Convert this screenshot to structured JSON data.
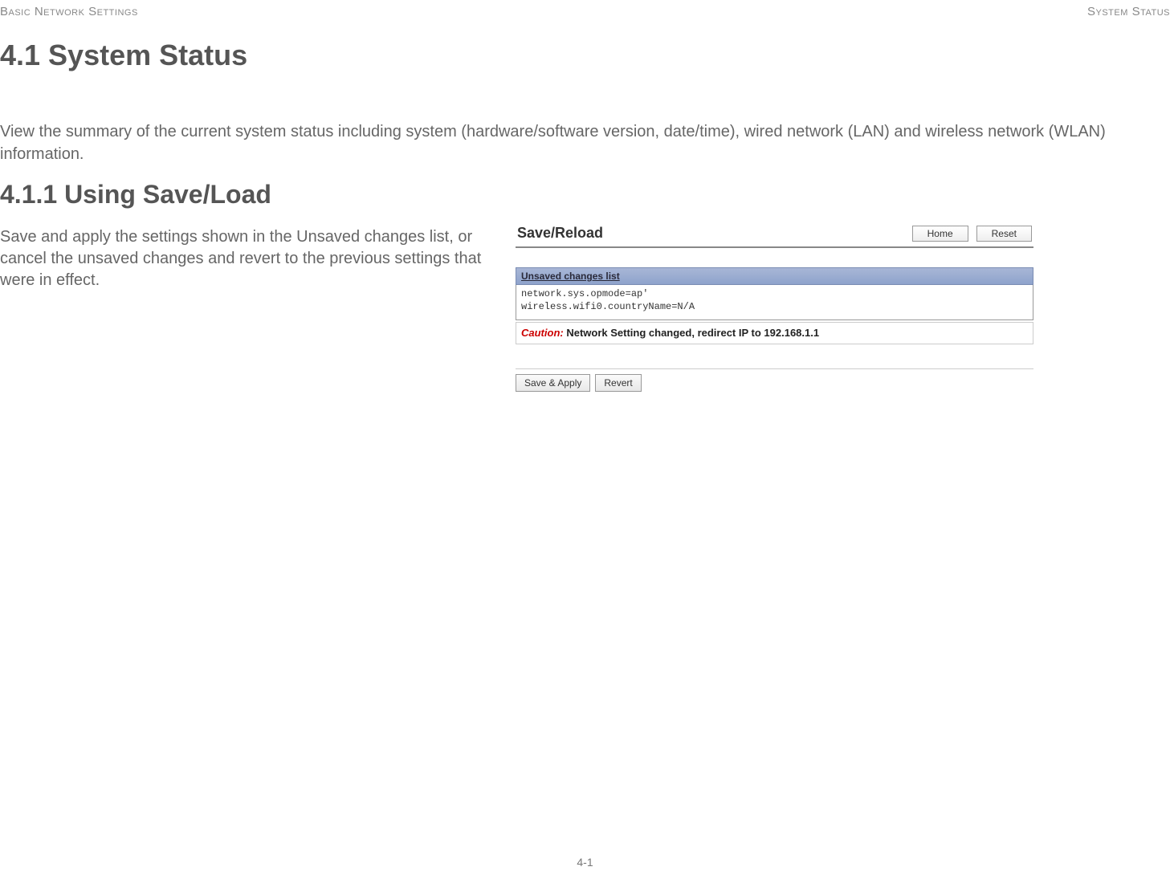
{
  "header": {
    "left": "Basic Network Settings",
    "right": "System Status"
  },
  "section": {
    "heading": "4.1 System Status",
    "description": "View the summary of the current system status including system (hardware/software version, date/time), wired network (LAN) and wireless network (WLAN) information."
  },
  "subsection": {
    "heading": "4.1.1 Using Save/Load",
    "description": "Save and apply the settings shown in the Unsaved changes list, or cancel the unsaved changes and revert to the previous settings that were in effect."
  },
  "panel": {
    "title": "Save/Reload",
    "home_button": "Home",
    "reset_button": "Reset",
    "unsaved_header": "Unsaved changes list",
    "changes": "network.sys.opmode=ap'\nwireless.wifi0.countryName=N/A",
    "caution_label": "Caution:",
    "caution_text": "  Network Setting changed, redirect IP to 192.168.1.1",
    "save_apply_button": "Save & Apply",
    "revert_button": "Revert"
  },
  "footer": {
    "page_number": "4-1"
  }
}
